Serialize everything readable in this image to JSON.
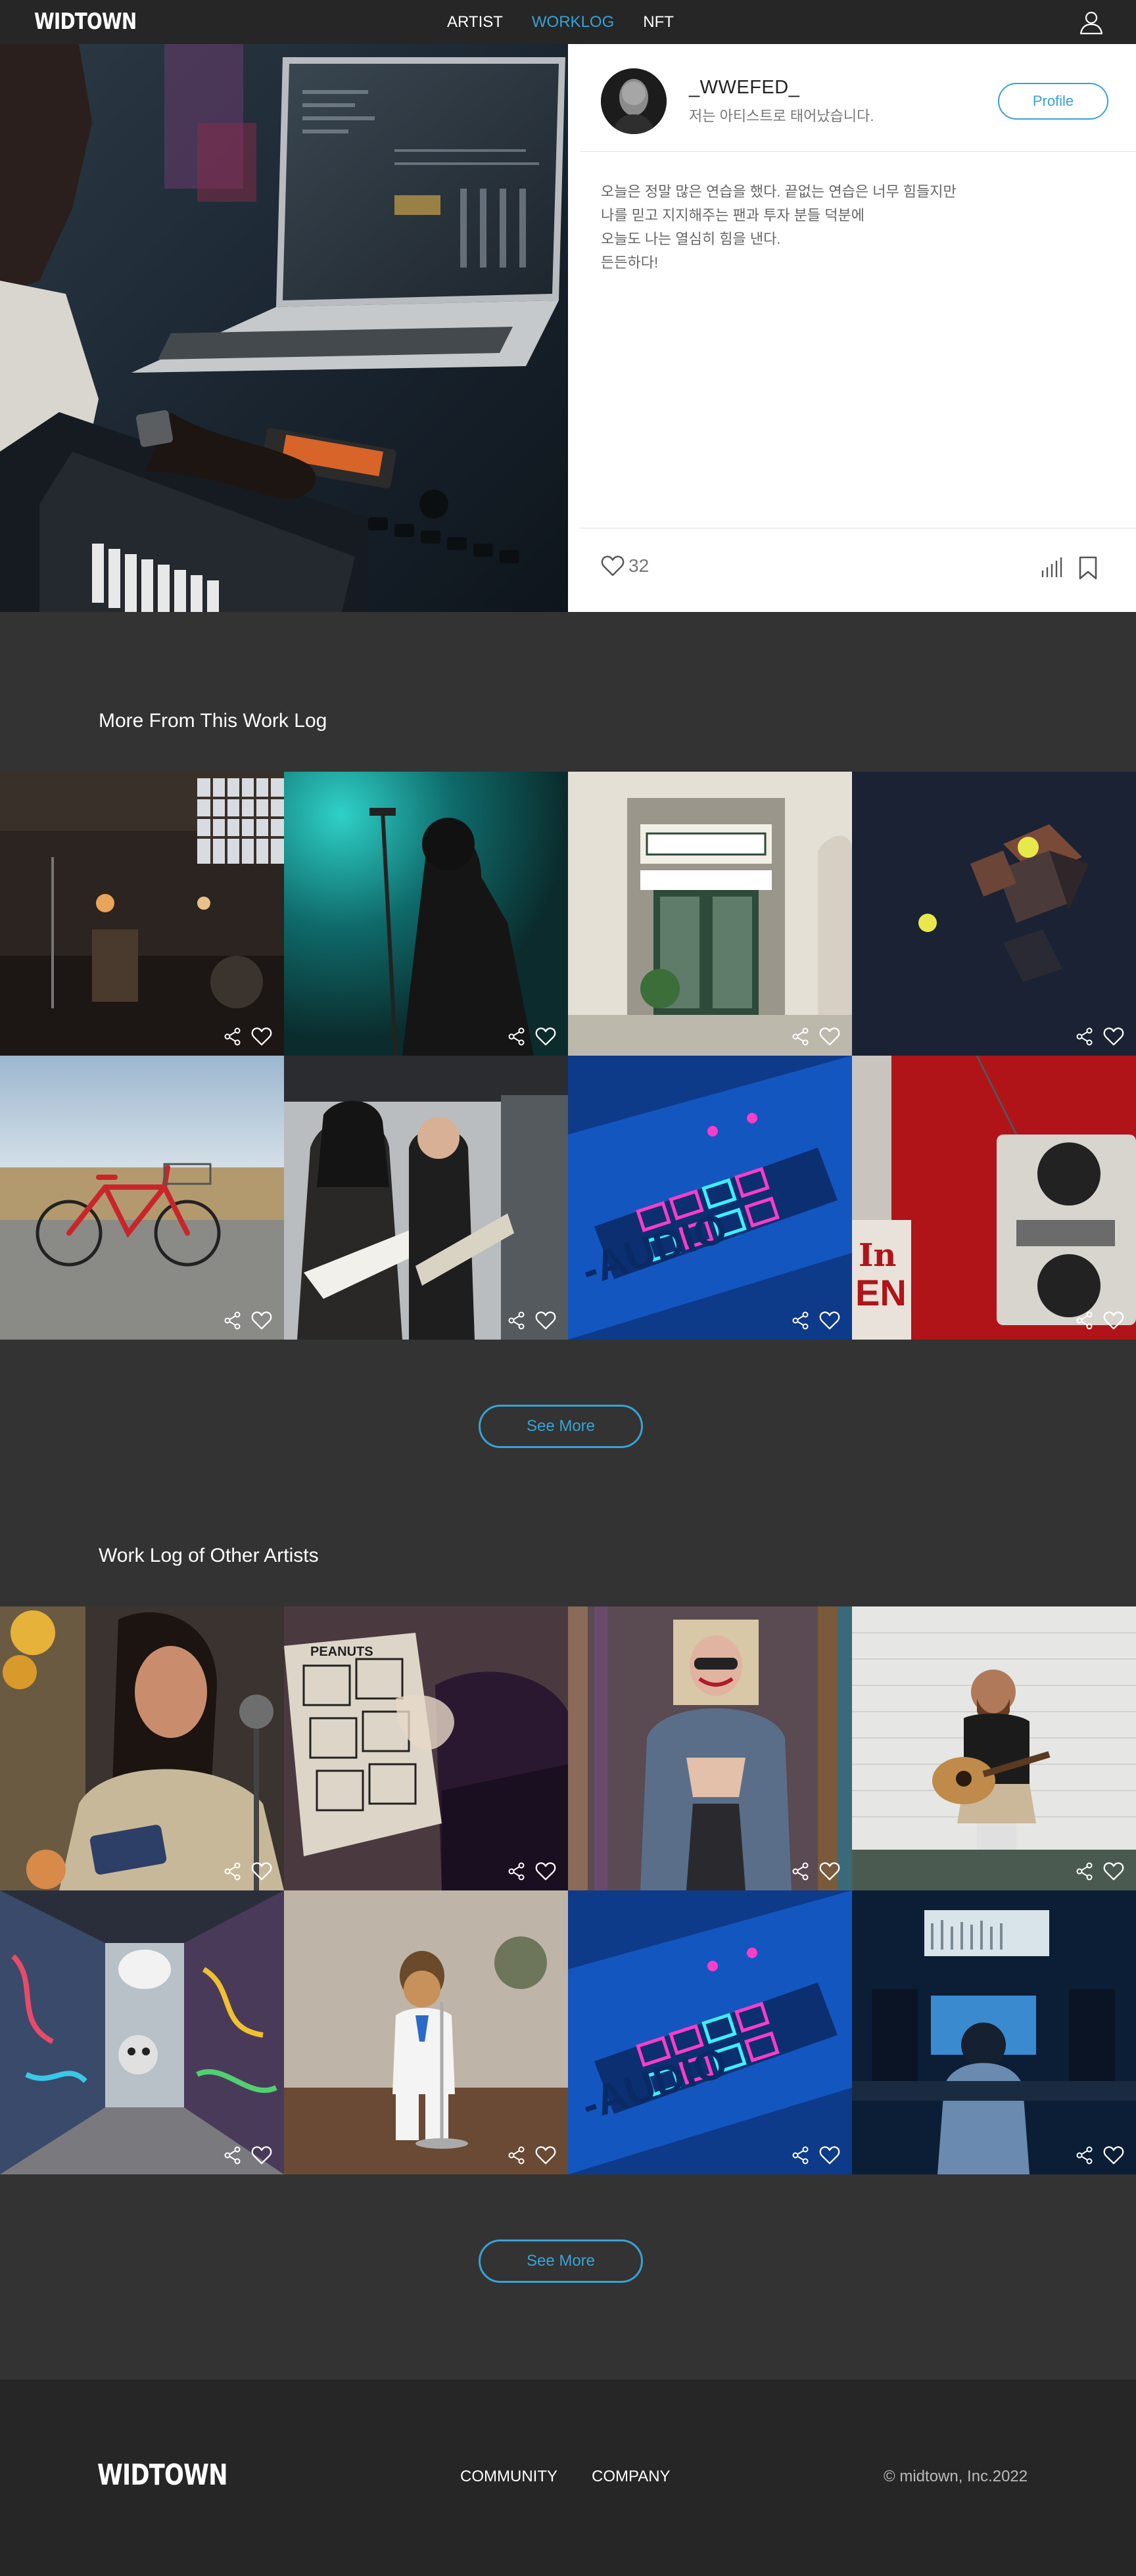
{
  "header": {
    "logo": "WIDTOWN",
    "nav": [
      {
        "label": "ARTIST",
        "active": false
      },
      {
        "label": "WORKLOG",
        "active": true
      },
      {
        "label": "NFT",
        "active": false
      }
    ],
    "user_icon": "user-icon"
  },
  "worklog": {
    "artist_name": "_WWEFED_",
    "artist_subtitle": "저는 아티스트로 태어났습니다.",
    "profile_button": "Profile",
    "post_lines": [
      "오늘은 정말 많은 연습을 했다. 끝없는 연습은 너무 힘들지만",
      "나를 믿고 지지해주는 팬과 투자 분들 덕분에",
      "오늘도 나는 열심히 힘을 낸다.",
      "든든하다!"
    ],
    "like_count": "32"
  },
  "more_from": {
    "title": "More From This Work Log",
    "see_more": "See More"
  },
  "other_artists": {
    "title": "Work Log of Other Artists",
    "see_more": "See More"
  },
  "footer": {
    "logo": "WIDTOWN",
    "links": [
      "COMMUNITY",
      "COMPANY"
    ],
    "copyright": "© midtown, Inc.2022"
  },
  "colors": {
    "accent": "#37a3d5",
    "background": "#333333",
    "header": "#262626"
  }
}
